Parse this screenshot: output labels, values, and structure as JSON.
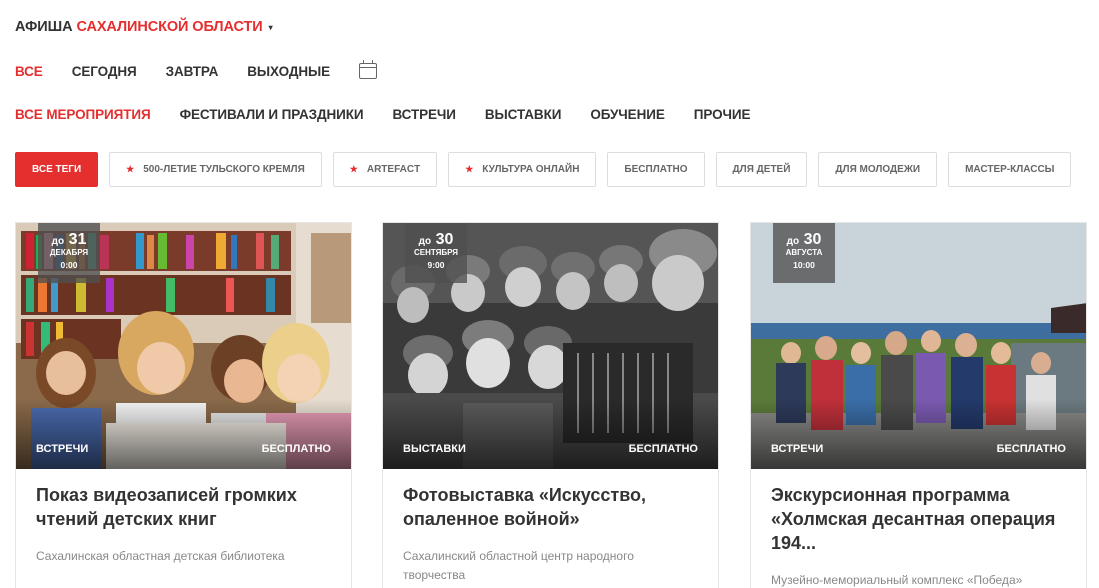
{
  "header": {
    "prefix": "АФИША",
    "region": "САХАЛИНСКОЙ ОБЛАСТИ",
    "caret": "▾"
  },
  "date_nav": [
    "ВСЕ",
    "СЕГОДНЯ",
    "ЗАВТРА",
    "ВЫХОДНЫЕ"
  ],
  "date_nav_icon": "calendar-icon",
  "categories": [
    "ВСЕ МЕРОПРИЯТИЯ",
    "ФЕСТИВАЛИ И ПРАЗДНИКИ",
    "ВСТРЕЧИ",
    "ВЫСТАВКИ",
    "ОБУЧЕНИЕ",
    "ПРОЧИЕ"
  ],
  "tags": [
    {
      "label": "ВСЕ ТЕГИ",
      "star": false
    },
    {
      "label": "500-ЛЕТИЕ ТУЛЬСКОГО КРЕМЛЯ",
      "star": true
    },
    {
      "label": "ARTEFACT",
      "star": true
    },
    {
      "label": "КУЛЬТУРА ОНЛАЙН",
      "star": true
    },
    {
      "label": "БЕСПЛАТНО",
      "star": false
    },
    {
      "label": "ДЛЯ ДЕТЕЙ",
      "star": false
    },
    {
      "label": "ДЛЯ МОЛОДЕЖИ",
      "star": false
    },
    {
      "label": "МАСТЕР-КЛАССЫ",
      "star": false
    }
  ],
  "star_glyph": "★",
  "colors": {
    "accent": "#e52e2e",
    "text": "#333333"
  },
  "cards": [
    {
      "badge": {
        "prefix": "до",
        "day": "31",
        "month": "ДЕКАБРЯ",
        "time": "0:00"
      },
      "category": "ВСТРЕЧИ",
      "price": "БЕСПЛАТНО",
      "title": "Показ видеозаписей громких чтений детских книг",
      "place": "Сахалинская областная детская библиотека"
    },
    {
      "badge": {
        "prefix": "до",
        "day": "30",
        "month": "СЕНТЯБРЯ",
        "time": "9:00"
      },
      "category": "ВЫСТАВКИ",
      "price": "БЕСПЛАТНО",
      "title": "Фотовыставка «Искусство, опаленное войной»",
      "place": "Сахалинский областной центр народного творчества"
    },
    {
      "badge": {
        "prefix": "до",
        "day": "30",
        "month": "АВГУСТА",
        "time": "10:00"
      },
      "category": "ВСТРЕЧИ",
      "price": "БЕСПЛАТНО",
      "title": "Экскурсионная программа «Холмская десантная операция 194...",
      "place": "Музейно-мемориальный комплекс «Победа»"
    }
  ]
}
